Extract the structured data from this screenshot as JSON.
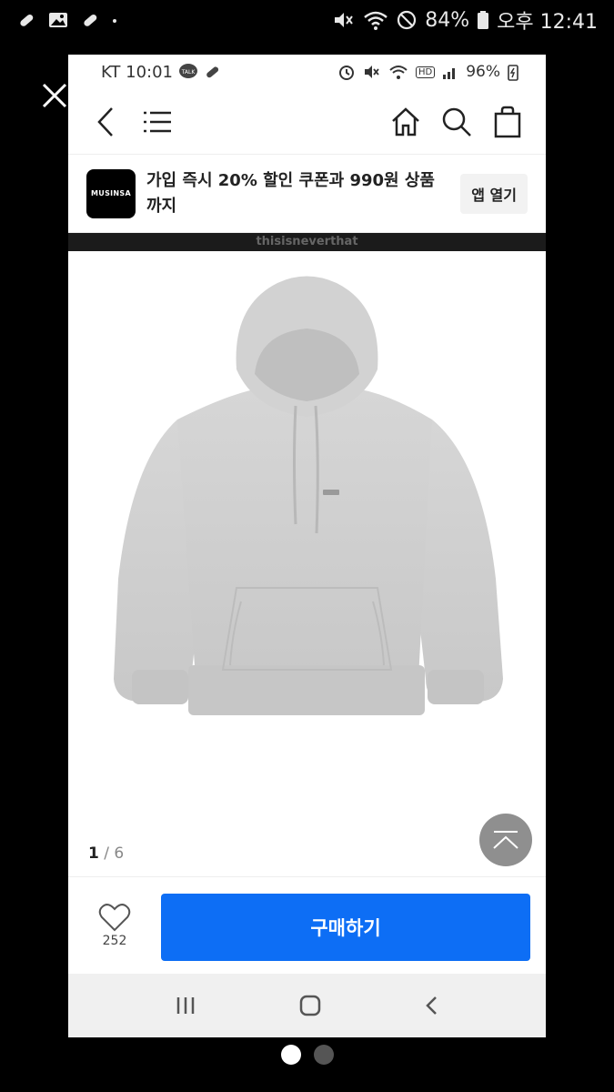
{
  "outer_status": {
    "battery": "84%",
    "time": "오후 12:41"
  },
  "inner_status": {
    "carrier_time": "KT 10:01",
    "talk_badge": "TALK",
    "battery": "96%",
    "hd": "HD"
  },
  "banner": {
    "logo_text": "MUSINSA",
    "text": "가입 즉시 20% 할인 쿠폰과 990원 상품까지",
    "open_app": "앱 열기"
  },
  "brand_strip": "thisisneverthat",
  "product": {
    "page_current": "1",
    "page_total": "/ 6"
  },
  "bottom": {
    "like_count": "252",
    "buy_label": "구매하기"
  },
  "colors": {
    "accent": "#0d6ef5",
    "hoodie": "#cfcfcf"
  }
}
